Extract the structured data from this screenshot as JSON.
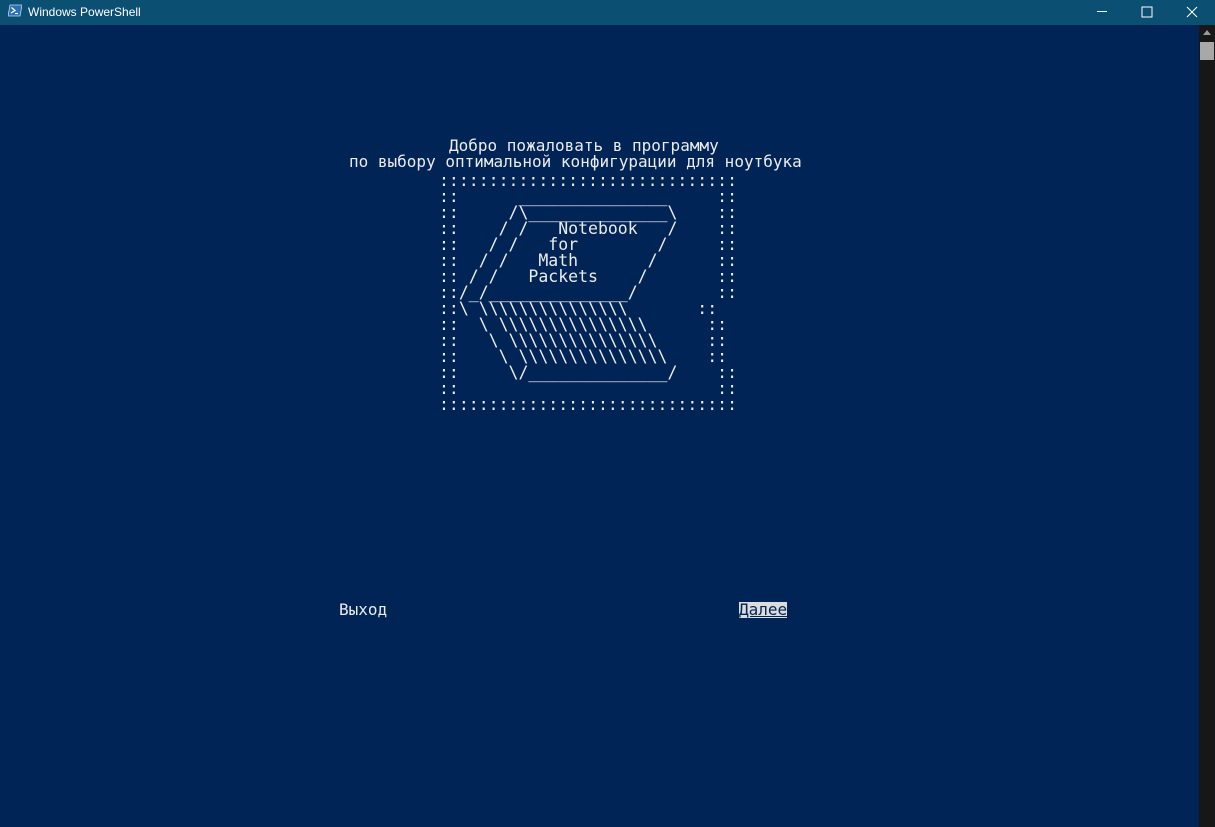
{
  "window": {
    "title": "Windows PowerShell",
    "icon": "powershell-icon",
    "controls": [
      "minimize-icon",
      "maximize-icon",
      "close-icon"
    ]
  },
  "console": {
    "welcome_line1": "Добро пожаловать в программу",
    "welcome_line2": "по выбору оптимальной конфигурации для ноутбука",
    "logo_art": "::::::::::::::::::::::::::::::\n::      _______________     ::\n::     /\\______________\\    ::\n::    / /   Notebook   /    ::\n::   / /   for        /     ::\n::  / /   Math       /      ::\n:: / /   Packets    /       ::\n::/_/______________/        ::\n::\\ \\\\\\\\\\\\\\\\\\\\\\\\\\\\\\       ::\n::  \\ \\\\\\\\\\\\\\\\\\\\\\\\\\\\\\      ::\n::   \\ \\\\\\\\\\\\\\\\\\\\\\\\\\\\\\     ::\n::    \\ \\\\\\\\\\\\\\\\\\\\\\\\\\\\\\    ::\n::     \\/______________/    ::\n::                          ::\n::::::::::::::::::::::::::::::",
    "exit_button": "Выход",
    "next_button": "Далее"
  },
  "colors": {
    "background": "#012456",
    "titlebar": "#0b4f73",
    "text": "#ececec",
    "selected_bg": "#dcdcdc"
  }
}
